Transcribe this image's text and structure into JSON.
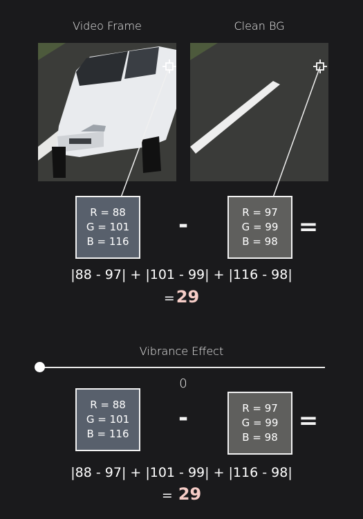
{
  "labels": {
    "video_frame": "Video Frame",
    "clean_bg": "Clean BG",
    "vibrance_effect": "Vibrance Effect"
  },
  "top": {
    "video_pixel": {
      "r": "R = 88",
      "g": "G = 101",
      "b": "B = 116"
    },
    "bg_pixel": {
      "r": "R = 97",
      "g": "G = 99",
      "b": "B = 98"
    },
    "minus": "-",
    "equals": "=",
    "formula": "|88 - 97| + |101 - 99| + |116 - 98|",
    "result_prefix": "=",
    "result": "29"
  },
  "slider": {
    "value_text": "0",
    "value": 0
  },
  "bottom": {
    "video_pixel": {
      "r": "R = 88",
      "g": "G = 101",
      "b": "B = 116"
    },
    "bg_pixel": {
      "r": "R = 97",
      "g": "G = 99",
      "b": "B = 98"
    },
    "minus": "-",
    "equals": "=",
    "formula": "|88 - 97| + |101 - 99| + |116 - 98|",
    "result_prefix": "=",
    "result": "29"
  },
  "colors": {
    "background": "#1a1a1c",
    "result_accent": "#f6cdc7",
    "video_pixel_fill": "#58606c",
    "bg_pixel_fill": "#5f5f5d"
  },
  "icons": [
    "crosshair-icon"
  ]
}
